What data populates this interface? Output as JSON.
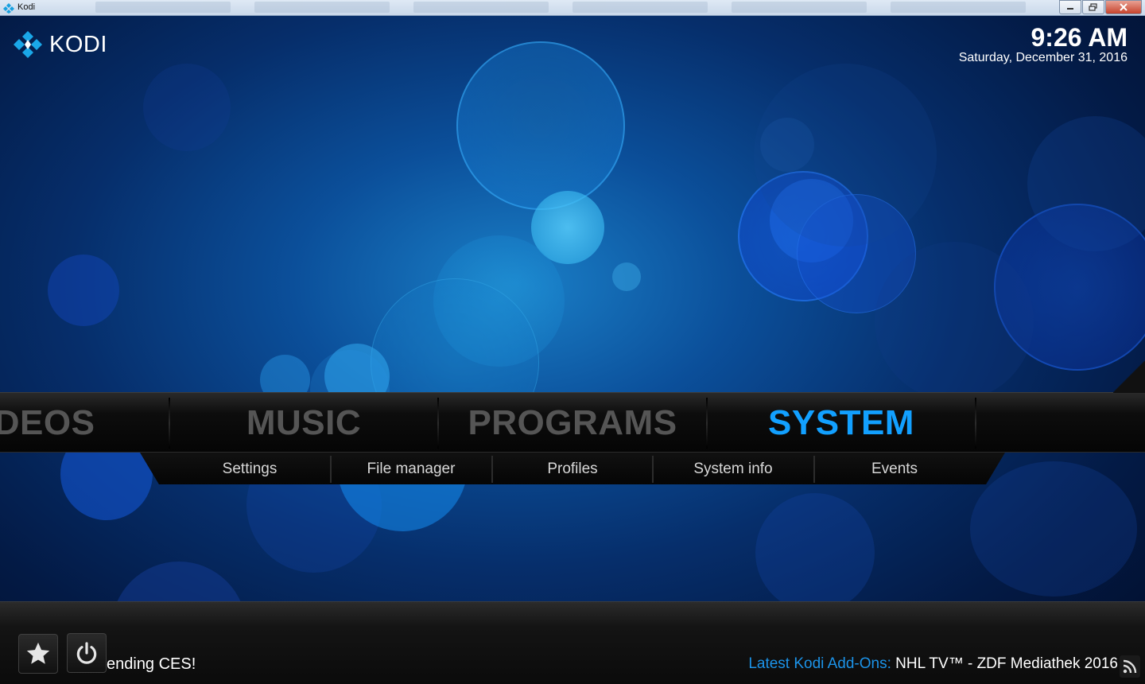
{
  "window": {
    "title": "Kodi",
    "controls": {
      "minimize_icon": "minimize-icon",
      "restore_icon": "restore-icon",
      "close_icon": "close-icon"
    }
  },
  "header": {
    "logo_text": "KODI",
    "time": "9:26 AM",
    "date": "Saturday, December 31, 2016"
  },
  "main_menu": {
    "items": [
      {
        "label": "IDEOS",
        "active": false
      },
      {
        "label": "MUSIC",
        "active": false
      },
      {
        "label": "PROGRAMS",
        "active": false
      },
      {
        "label": "SYSTEM",
        "active": true
      }
    ]
  },
  "submenu": {
    "items": [
      {
        "label": "Settings"
      },
      {
        "label": "File manager"
      },
      {
        "label": "Profiles"
      },
      {
        "label": "System info"
      },
      {
        "label": "Events"
      }
    ]
  },
  "footer": {
    "favourites_icon": "star-icon",
    "power_icon": "power-icon",
    "ticker_left": "ending CES!",
    "ticker_label": "Latest Kodi Add-Ons:",
    "ticker_value": " NHL TV™ - ZDF Mediathek 2016",
    "rss_icon": "rss-icon"
  },
  "colors": {
    "accent": "#12a0ff",
    "ticker_label": "#1c93e8",
    "inactive_menu": "#555555"
  }
}
